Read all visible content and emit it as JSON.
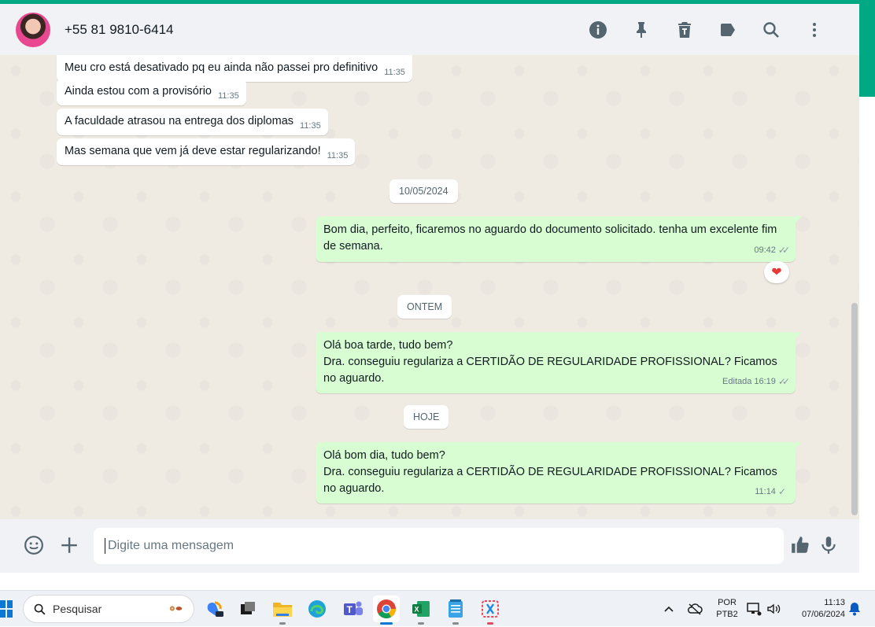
{
  "header": {
    "contact_name": "+55 81 9810-6414",
    "icons": [
      "info-icon",
      "pin-icon",
      "trash-icon",
      "label-icon",
      "search-icon",
      "more-vertical-icon"
    ]
  },
  "messages": {
    "incoming": [
      {
        "text": "Meu cro está desativado pq eu ainda não passei pro definitivo",
        "time": "11:35"
      },
      {
        "text": "Ainda estou com a provisório",
        "time": "11:35"
      },
      {
        "text": "A faculdade atrasou na entrega dos diplomas",
        "time": "11:35"
      },
      {
        "text": "Mas semana que vem já deve estar regularizando!",
        "time": "11:35"
      }
    ],
    "date_1": "10/05/2024",
    "out_1": {
      "text": "Bom dia, perfeito, ficaremos no aguardo do documento solicitado. tenha um excelente fim de semana.",
      "time": "09:42",
      "status": "read",
      "reaction": "❤"
    },
    "date_2": "ONTEM",
    "out_2": {
      "line1": "Olá boa tarde, tudo bem?",
      "line2": "Dra. conseguiu regulariza a CERTIDÃO DE REGULARIDADE PROFISSIONAL? Ficamos no aguardo.",
      "edited_label": "Editada",
      "time": "16:19",
      "status": "read"
    },
    "date_3": "HOJE",
    "out_3": {
      "line1": "Olá bom dia, tudo bem?",
      "line2": "Dra. conseguiu regulariza a CERTIDÃO DE REGULARIDADE PROFISSIONAL? Ficamos no aguardo.",
      "time": "11:14",
      "status": "sent"
    }
  },
  "composer": {
    "placeholder": "Digite uma mensagem"
  },
  "taskbar": {
    "search_label": "Pesquisar",
    "language_line1": "POR",
    "language_line2": "PTB2",
    "clock_time": "11:13",
    "clock_date": "07/06/2024",
    "apps": [
      "copilot-icon",
      "task-view-icon",
      "file-explorer-icon",
      "edge-icon",
      "teams-icon",
      "chrome-icon",
      "excel-icon",
      "notepad-icon",
      "snipping-tool-icon"
    ],
    "active_app": "chrome-icon"
  },
  "colors": {
    "accent": "#00a884",
    "outgoing_bubble": "#d9fdd3",
    "incoming_bubble": "#ffffff",
    "chat_background": "#efeae2",
    "read_tick": "#8696a0"
  }
}
